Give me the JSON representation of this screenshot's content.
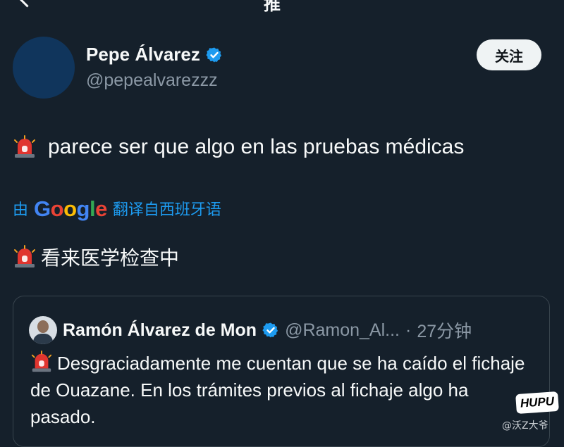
{
  "header": {
    "title_fragment": "推",
    "back_icon": "arrow-left-icon"
  },
  "author": {
    "name": "Pepe Álvarez",
    "handle": "@pepealvarezzz",
    "verified_icon": "verified-badge-icon",
    "avatar_color": "#10355c",
    "follow_label": "关注"
  },
  "tweet": {
    "emoji_icon": "police-siren-icon",
    "text": "parece ser que algo en las pruebas médicas"
  },
  "translation": {
    "prefix": "由",
    "provider_logo_letters": [
      "G",
      "o",
      "o",
      "g",
      "l",
      "e"
    ],
    "suffix": "翻译自西班牙语",
    "emoji_icon": "police-siren-icon",
    "translated_text": "看来医学检查中"
  },
  "quoted_tweet": {
    "name": "Ramón Álvarez de Mon",
    "handle": "@Ramon_Al...",
    "separator": "·",
    "time": "27分钟",
    "emoji_icon": "police-siren-icon",
    "text": "Desgraciadamente me cuentan que se ha caído el fichaje de Ouazane. En los trámites previos al fichaje algo ha pasado."
  },
  "overlay": {
    "badge": "HUPU",
    "watermark": "@沃Z大爷"
  },
  "colors": {
    "background": "#15202b",
    "text_primary": "#f7f9f9",
    "text_secondary": "#8b98a5",
    "link_blue": "#1d9bf0",
    "verified_blue": "#1d9bf0",
    "card_border": "#38444d",
    "follow_button_bg": "#eff3f4"
  }
}
